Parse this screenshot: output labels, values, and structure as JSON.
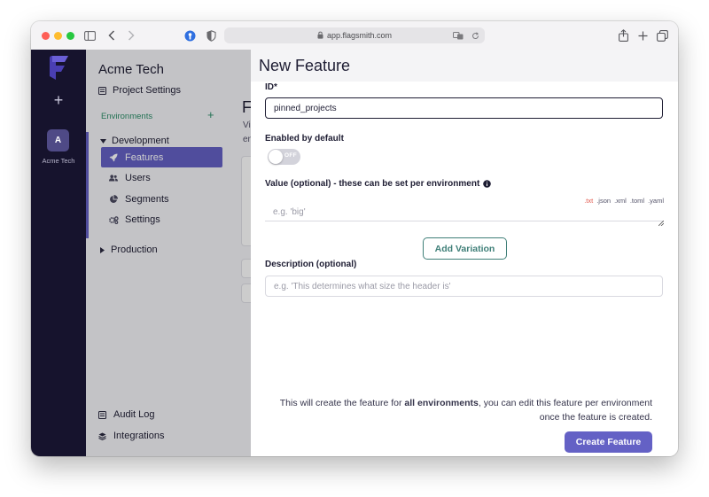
{
  "browser": {
    "url": "app.flagsmith.com"
  },
  "rail": {
    "add_glyph": "+",
    "org_initial": "A",
    "org_name": "Acme Tech"
  },
  "sidebar": {
    "org_title": "Acme Tech",
    "project_settings": "Project Settings",
    "environments_label": "Environments",
    "add_glyph": "+",
    "env_development": "Development",
    "items": [
      {
        "label": "Features",
        "icon": "rocket-icon",
        "active": true
      },
      {
        "label": "Users",
        "icon": "users-icon",
        "active": false
      },
      {
        "label": "Segments",
        "icon": "pie-chart-icon",
        "active": false
      },
      {
        "label": "Settings",
        "icon": "cogs-icon",
        "active": false
      }
    ],
    "env_production": "Production",
    "audit_log": "Audit Log",
    "integrations": "Integrations"
  },
  "background": {
    "heading_fragment": "F",
    "line1_fragment": "Vi",
    "line2_fragment": "en"
  },
  "modal": {
    "title": "New Feature",
    "id_label": "ID*",
    "id_value": "pinned_projects",
    "enabled_label": "Enabled by default",
    "toggle_text": "OFF",
    "toggle_on": false,
    "value_label": "Value (optional) - these can be set per environment",
    "file_types": [
      ".txt",
      ".json",
      ".xml",
      ".toml",
      ".yaml"
    ],
    "value_placeholder": "e.g. 'big'",
    "add_variation": "Add Variation",
    "description_label": "Description (optional)",
    "description_placeholder": "e.g. 'This determines what size the header is'",
    "footer_text_prefix": "This will create the feature for ",
    "footer_text_bold": "all environments",
    "footer_text_suffix": ", you can edit this feature per environment",
    "footer_text_line2": "once the feature is created.",
    "create_button": "Create Feature"
  },
  "colors": {
    "primary": "#6461c5",
    "teal": "#3f7f78",
    "rail": "#16132d",
    "green": "#3aa07a",
    "txt_red": "#e2594d"
  }
}
